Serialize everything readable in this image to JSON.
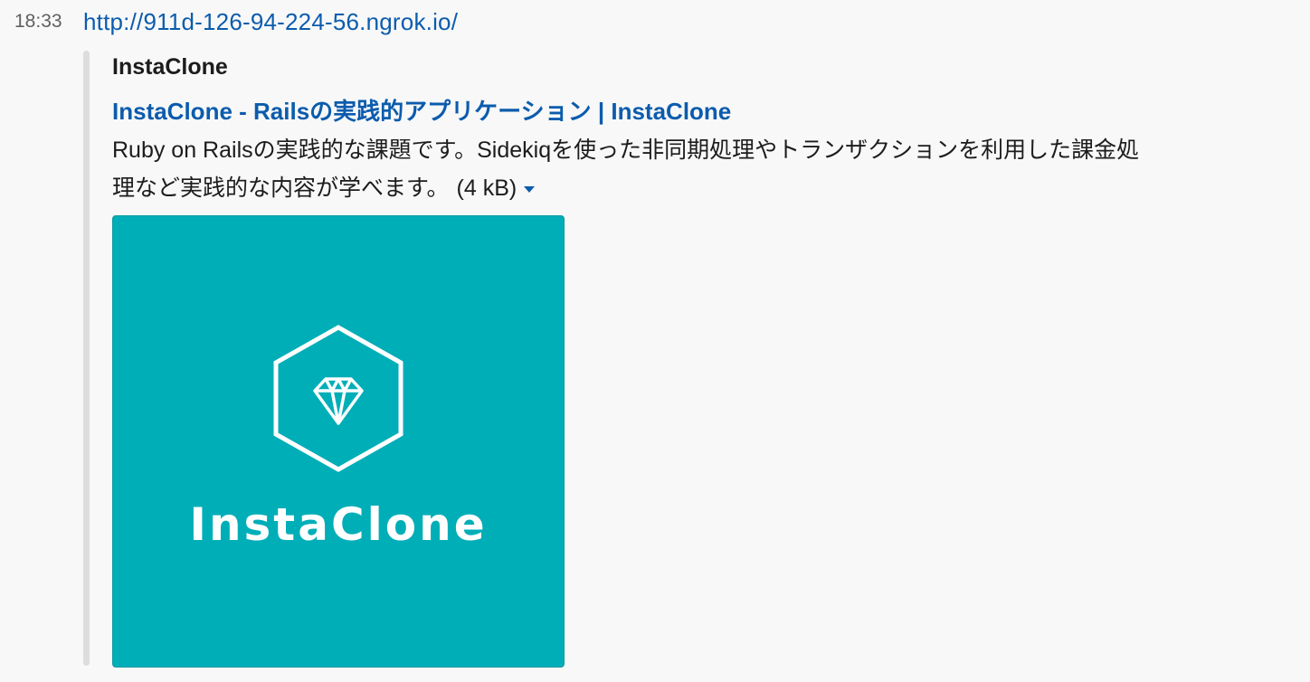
{
  "message": {
    "timestamp": "18:33",
    "link_text": "http://911d-126-94-224-56.ngrok.io/"
  },
  "attachment": {
    "service_name": "InstaClone",
    "title": "InstaClone - Railsの実践的アプリケーション | InstaClone",
    "description": "Ruby on Railsの実践的な課題です。Sidekiqを使った非同期処理やトランザクションを利用した課金処理など実践的な内容が学べます。",
    "file_size": "(4 kB)",
    "image": {
      "logo_text": "InstaClone",
      "background_color": "#00aeb8",
      "icon": "diamond-hexagon-icon"
    }
  },
  "colors": {
    "link": "#0b5cad",
    "bar": "#dddddd",
    "background": "#f8f8f8"
  }
}
